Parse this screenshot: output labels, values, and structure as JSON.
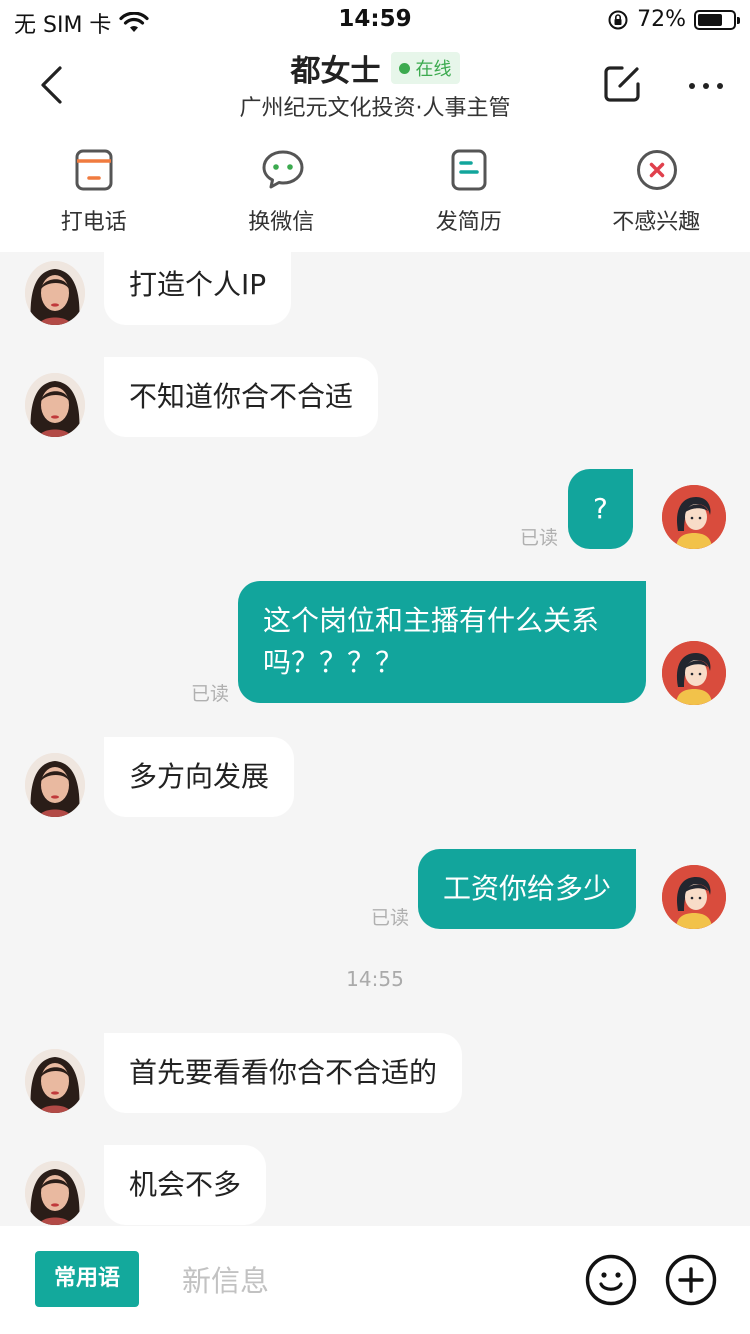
{
  "status_bar": {
    "carrier": "无 SIM 卡",
    "time": "14:59",
    "battery_percent": "72%",
    "battery_level": 0.72
  },
  "header": {
    "name": "都女士",
    "online_badge": "在线",
    "subtitle": "广州纪元文化投资·人事主管"
  },
  "actions": [
    {
      "label": "打电话",
      "icon": "phone-icon"
    },
    {
      "label": "换微信",
      "icon": "wechat-icon"
    },
    {
      "label": "发简历",
      "icon": "resume-icon"
    },
    {
      "label": "不感兴趣",
      "icon": "not-interested-icon"
    }
  ],
  "messages": [
    {
      "side": "left",
      "text": "打造个人IP"
    },
    {
      "side": "left",
      "text": "不知道你合不合适"
    },
    {
      "side": "right",
      "text": "?",
      "status": "已读"
    },
    {
      "side": "right",
      "text": "这个岗位和主播有什么关系吗？？？？",
      "status": "已读"
    },
    {
      "side": "left",
      "text": "多方向发展"
    },
    {
      "side": "right",
      "text": "工资你给多少",
      "status": "已读"
    },
    {
      "timestamp": "14:55"
    },
    {
      "side": "left",
      "text": "首先要看看你合不合适的"
    },
    {
      "side": "left",
      "text": "机会不多"
    }
  ],
  "input_bar": {
    "quick_phrases_label": "常用语",
    "placeholder": "新信息",
    "value": ""
  },
  "colors": {
    "accent": "#12a59c",
    "online": "#3caa4f",
    "background": "#f5f5f5"
  }
}
